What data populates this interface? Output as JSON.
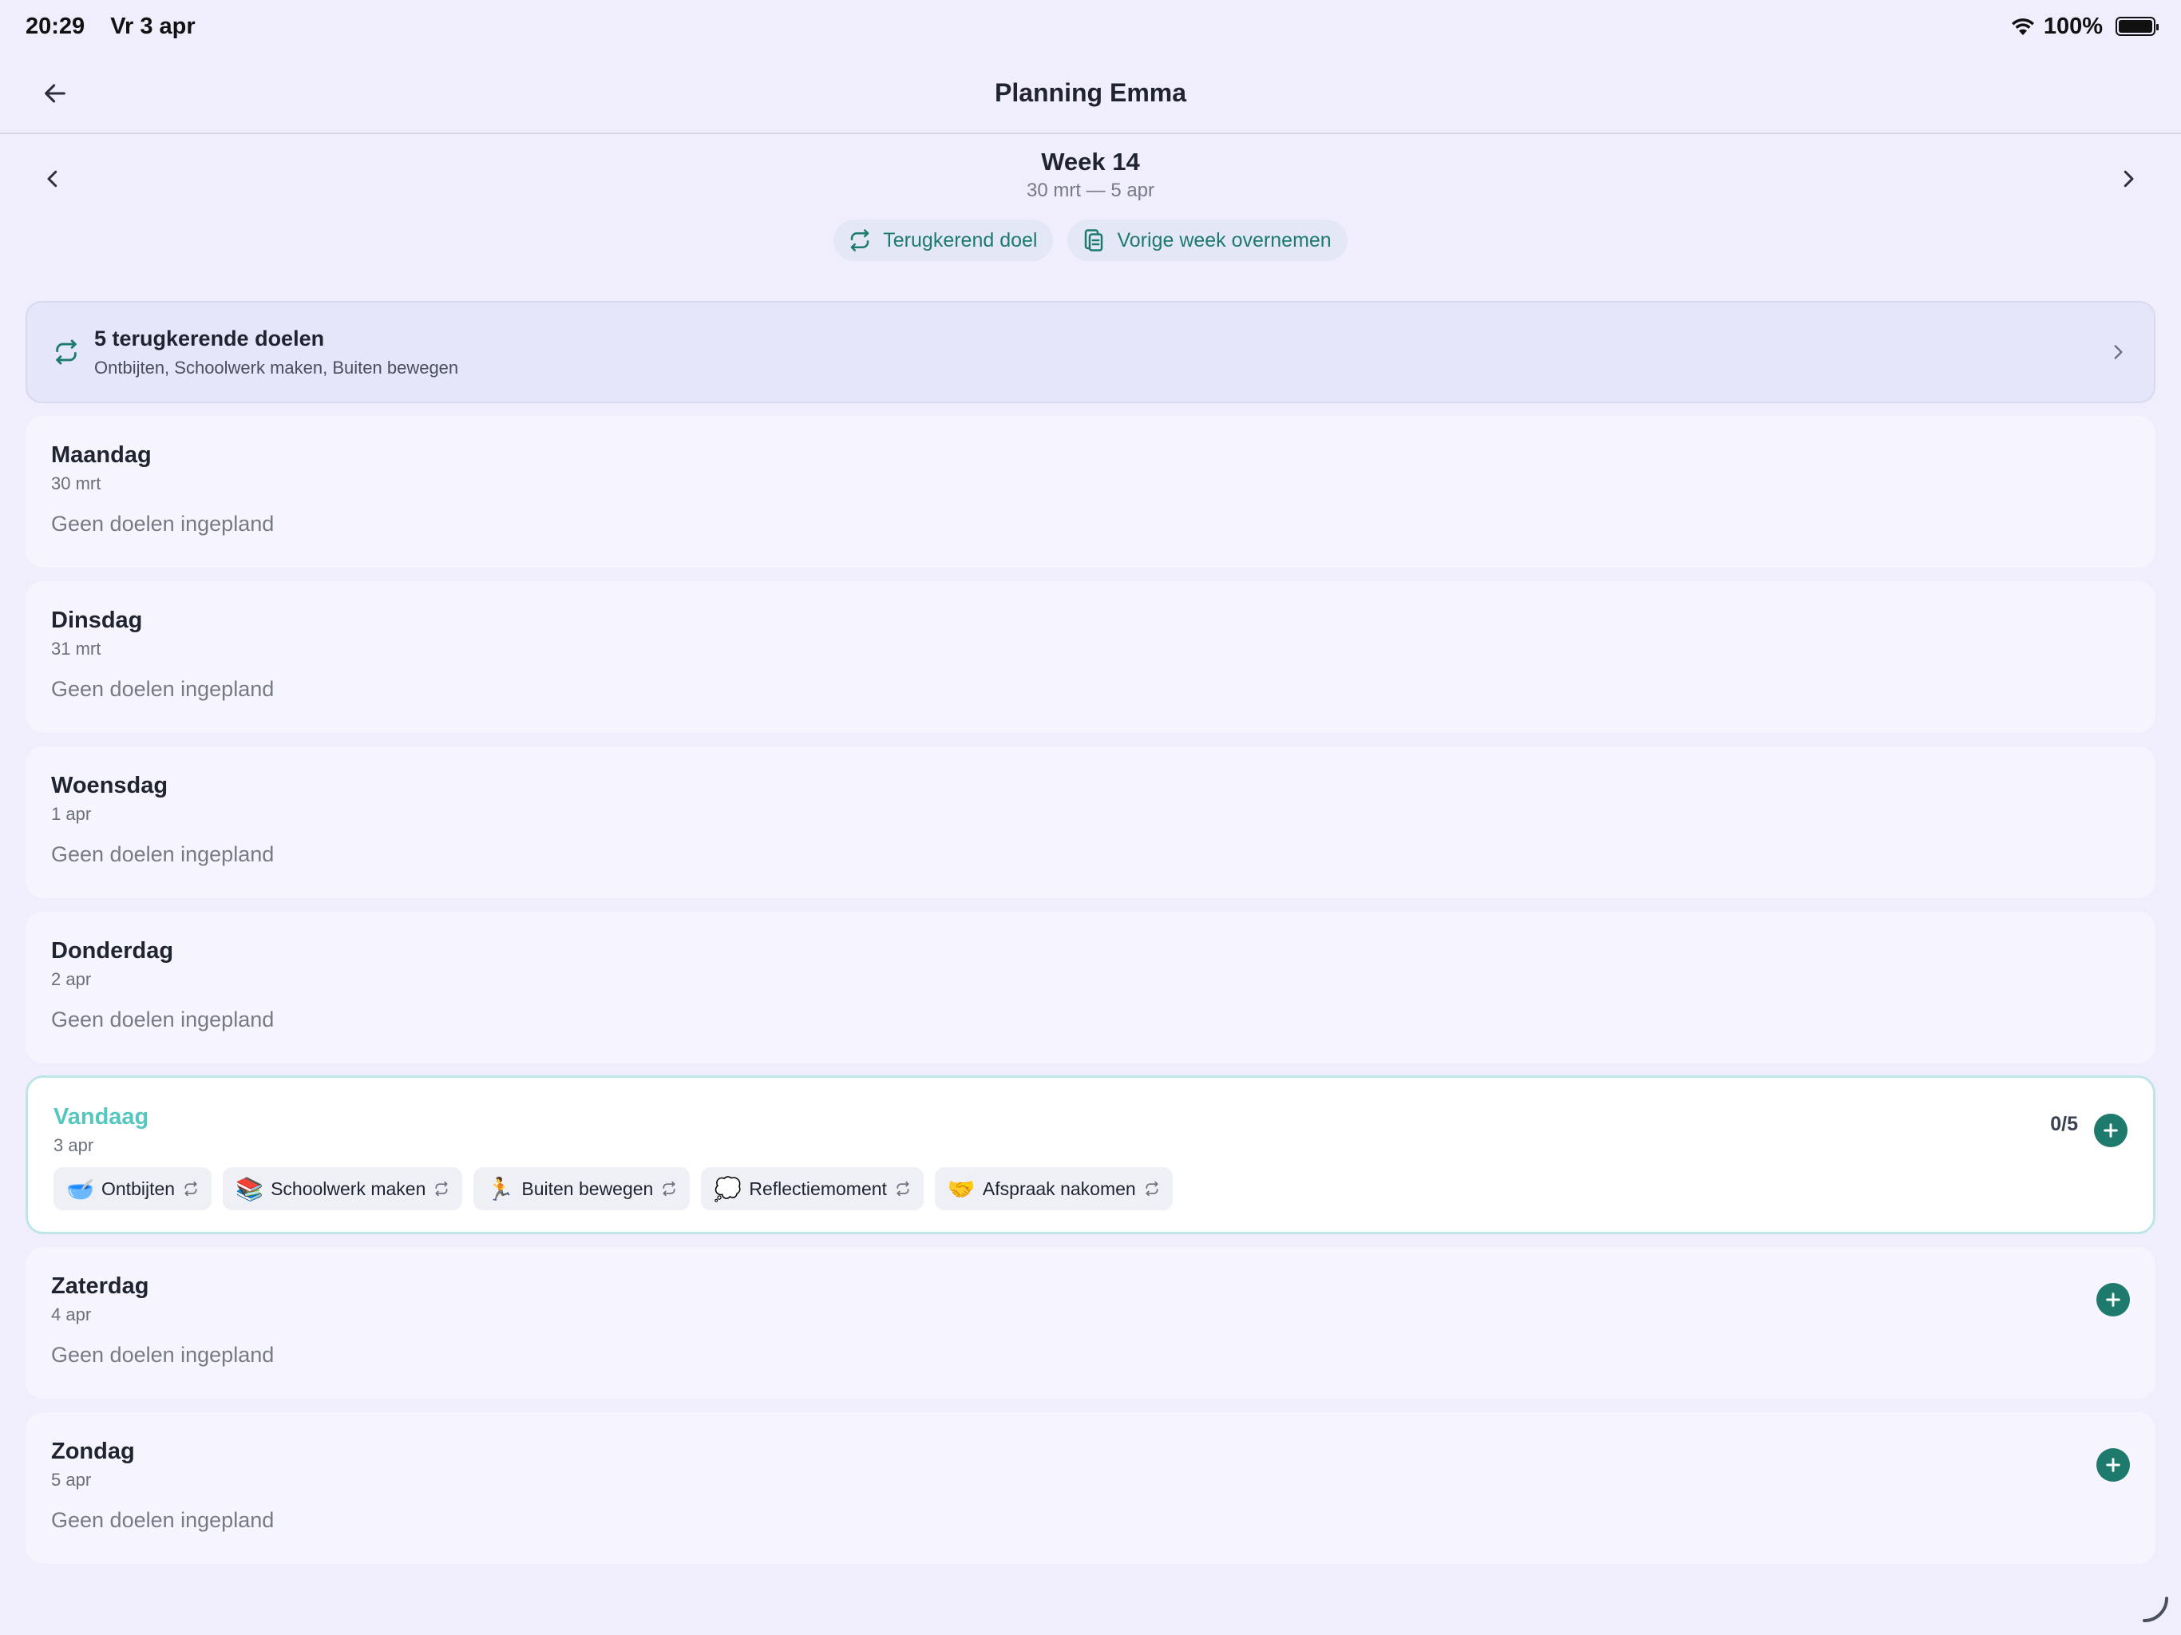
{
  "status": {
    "time": "20:29",
    "date": "Vr 3 apr",
    "battery": "100%"
  },
  "nav": {
    "title": "Planning Emma"
  },
  "week": {
    "title": "Week 14",
    "range": "30 mrt — 5 apr",
    "actions": {
      "recurring_label": "Terugkerend doel",
      "copy_label": "Vorige week overnemen"
    }
  },
  "recurring": {
    "title": "5 terugkerende doelen",
    "subtitle": "Ontbijten, Schoolwerk maken, Buiten bewegen"
  },
  "days": [
    {
      "name": "Maandag",
      "date": "30 mrt",
      "empty": "Geen doelen ingepland"
    },
    {
      "name": "Dinsdag",
      "date": "31 mrt",
      "empty": "Geen doelen ingepland"
    },
    {
      "name": "Woensdag",
      "date": "1 apr",
      "empty": "Geen doelen ingepland"
    },
    {
      "name": "Donderdag",
      "date": "2 apr",
      "empty": "Geen doelen ingepland"
    },
    {
      "name": "Vandaag",
      "date": "3 apr",
      "count": "0/5",
      "goals": [
        {
          "emoji": "🥣",
          "label": "Ontbijten"
        },
        {
          "emoji": "📚",
          "label": "Schoolwerk maken"
        },
        {
          "emoji": "🏃",
          "label": "Buiten bewegen"
        },
        {
          "emoji": "💭",
          "label": "Reflectiemoment"
        },
        {
          "emoji": "🤝",
          "label": "Afspraak nakomen"
        }
      ]
    },
    {
      "name": "Zaterdag",
      "date": "4 apr",
      "empty": "Geen doelen ingepland"
    },
    {
      "name": "Zondag",
      "date": "5 apr",
      "empty": "Geen doelen ingepland"
    }
  ],
  "colors": {
    "accent": "#1e7a6d",
    "today": "#56c7be",
    "background": "#f0eefc"
  }
}
